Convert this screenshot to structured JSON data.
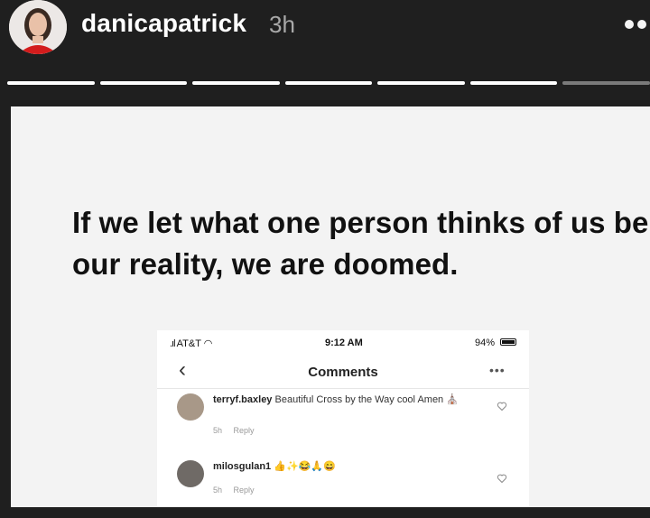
{
  "story_header": {
    "username": "danicapatrick",
    "time_ago": "3h",
    "progress_total_segments": 7,
    "progress_completed_segments": 6
  },
  "story": {
    "quote": "If we let what one person thinks of us be our reality, we are doomed."
  },
  "embedded_screenshot": {
    "status_bar": {
      "carrier": "AT&T",
      "time": "9:12 AM",
      "battery": "94%"
    },
    "nav": {
      "back": "‹",
      "title": "Comments",
      "more": "•••"
    },
    "comments": [
      {
        "username": "terryf.baxley",
        "text": "Beautiful Cross by the Way cool Amen ⛪",
        "age": "5h",
        "reply": "Reply"
      },
      {
        "username": "milosgulan1",
        "text": "👍✨😂🙏😄",
        "age": "5h",
        "reply": "Reply"
      }
    ]
  },
  "colors": {
    "header_bg": "#1f1f1f",
    "progress_active": "#ffffff",
    "progress_inactive": "#7a7a7a",
    "story_bg": "#f3f3f3"
  }
}
